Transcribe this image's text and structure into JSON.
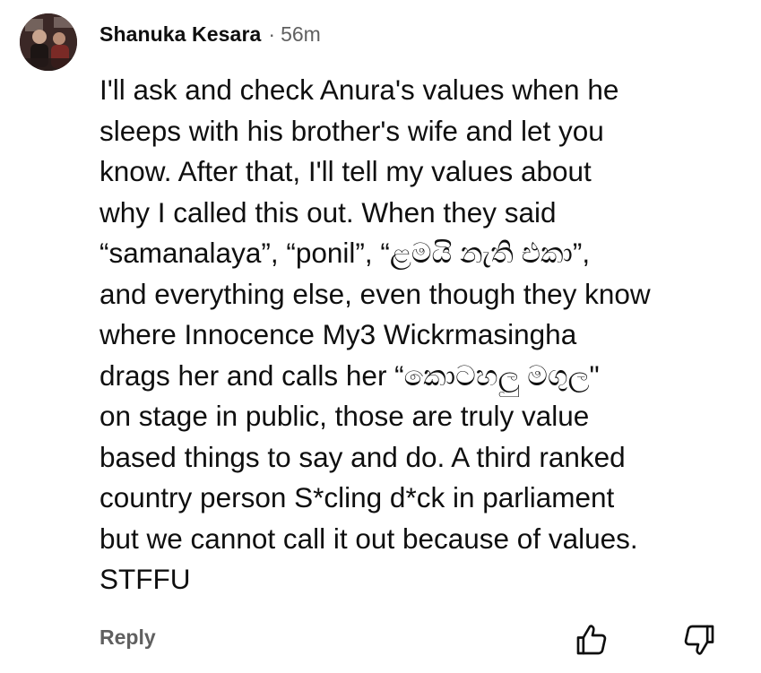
{
  "comment": {
    "author": "Shanuka Kesara",
    "separator": "·",
    "time": "56m",
    "lines": [
      "I'll ask and check Anura's values when he",
      "sleeps with his brother's wife and let you",
      "know. After that, I'll tell my values about",
      "why I called this out. When they said",
      "“samanalaya”, “ponil”, “ළමයි නැති එකා”,",
      "and everything else, even though they know",
      "where Innocence My3 Wickrmasingha",
      "drags her and calls her “කොටහලු මගුල\"",
      "on stage in public, those are truly value",
      "based things to say and do. A third ranked",
      "country person S*cling d*ck in parliament",
      "but we cannot call it out because of values.",
      "STFFU"
    ]
  },
  "actions": {
    "reply_label": "Reply",
    "like_icon": "thumbs-up-icon",
    "dislike_icon": "thumbs-down-icon"
  },
  "colors": {
    "text_primary": "#0f0f0f",
    "text_secondary": "#606060",
    "background": "#ffffff"
  }
}
